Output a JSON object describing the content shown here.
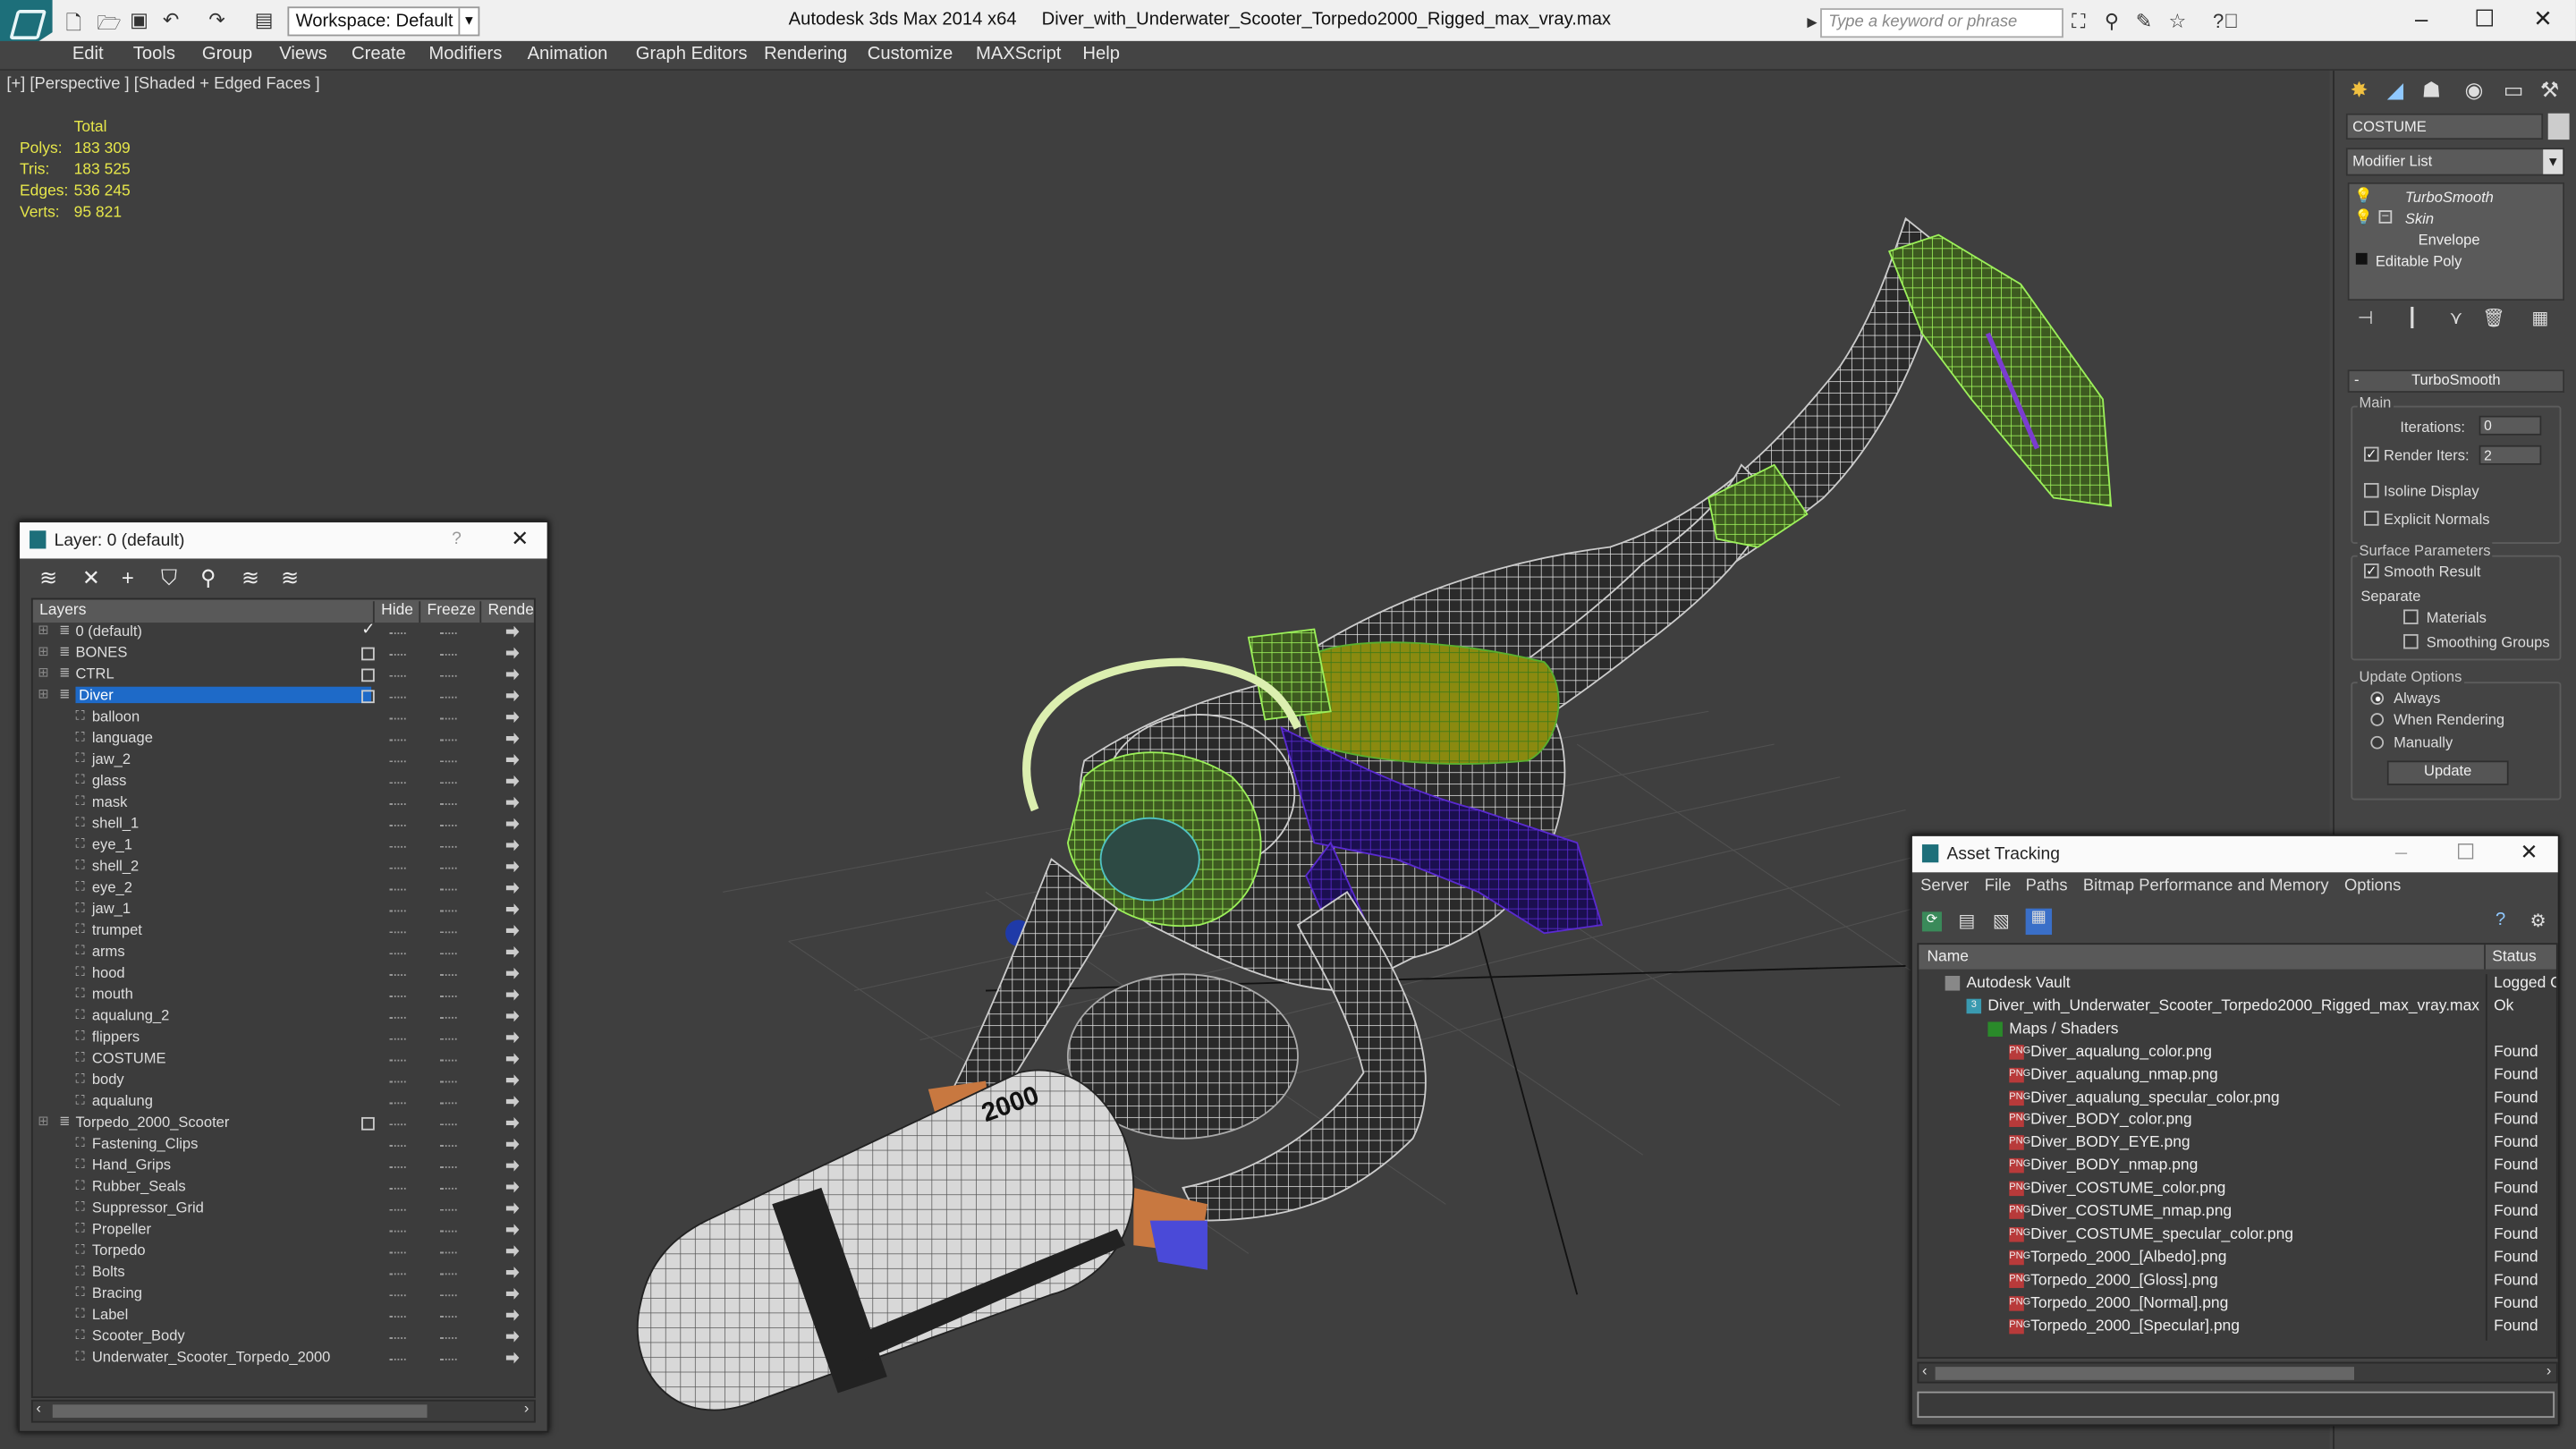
{
  "app": {
    "window_title": "Autodesk 3ds Max 2014 x64",
    "file_name": "Diver_with_Underwater_Scooter_Torpedo2000_Rigged_max_vray.max",
    "workspace": "Workspace: Default",
    "search_placeholder": "Type a keyword or phrase"
  },
  "menu": [
    "Edit",
    "Tools",
    "Group",
    "Views",
    "Create",
    "Modifiers",
    "Animation",
    "Graph Editors",
    "Rendering",
    "Customize",
    "MAXScript",
    "Help"
  ],
  "viewport": {
    "label": "[+] [Perspective ] [Shaded + Edged Faces ]",
    "stats_header": "Total",
    "stats": [
      {
        "k": "Polys:",
        "v": "183 309"
      },
      {
        "k": "Tris:",
        "v": "183 525"
      },
      {
        "k": "Edges:",
        "v": "536 245"
      },
      {
        "k": "Verts:",
        "v": "95 821"
      }
    ],
    "torpedo_text": "2000"
  },
  "command_panel": {
    "object_name": "COSTUME",
    "modifier_list": "Modifier List",
    "stack": [
      "TurboSmooth",
      "Skin",
      "Envelope",
      "Editable Poly"
    ],
    "rollout_title": "TurboSmooth",
    "main_group": "Main",
    "iterations_label": "Iterations:",
    "iterations_value": "0",
    "render_iters_label": "Render Iters:",
    "render_iters_value": "2",
    "isoline_display": "Isoline Display",
    "explicit_normals": "Explicit Normals",
    "surface_params": "Surface Parameters",
    "smooth_result": "Smooth Result",
    "separate": "Separate",
    "materials": "Materials",
    "smoothing_groups": "Smoothing Groups",
    "update_options": "Update Options",
    "always": "Always",
    "when_rendering": "When Rendering",
    "manually": "Manually",
    "update_button": "Update"
  },
  "layer_window": {
    "title": "Layer: 0 (default)",
    "help": "?",
    "columns": [
      "Layers",
      "Hide",
      "Freeze",
      "Render"
    ],
    "rows": [
      {
        "name": "0 (default)",
        "level": 0,
        "check": true
      },
      {
        "name": "BONES",
        "level": 0,
        "box": true
      },
      {
        "name": "CTRL",
        "level": 0,
        "box": true
      },
      {
        "name": "Diver",
        "level": 0,
        "box": true,
        "selected": true
      },
      {
        "name": "balloon",
        "level": 1
      },
      {
        "name": "language",
        "level": 1
      },
      {
        "name": "jaw_2",
        "level": 1
      },
      {
        "name": "glass",
        "level": 1
      },
      {
        "name": "mask",
        "level": 1
      },
      {
        "name": "shell_1",
        "level": 1
      },
      {
        "name": "eye_1",
        "level": 1
      },
      {
        "name": "shell_2",
        "level": 1
      },
      {
        "name": "eye_2",
        "level": 1
      },
      {
        "name": "jaw_1",
        "level": 1
      },
      {
        "name": "trumpet",
        "level": 1
      },
      {
        "name": "arms",
        "level": 1
      },
      {
        "name": "hood",
        "level": 1
      },
      {
        "name": "mouth",
        "level": 1
      },
      {
        "name": "aqualung_2",
        "level": 1
      },
      {
        "name": "flippers",
        "level": 1
      },
      {
        "name": "COSTUME",
        "level": 1
      },
      {
        "name": "body",
        "level": 1
      },
      {
        "name": "aqualung",
        "level": 1
      },
      {
        "name": "Torpedo_2000_Scooter",
        "level": 0,
        "box": true
      },
      {
        "name": "Fastening_Clips",
        "level": 1
      },
      {
        "name": "Hand_Grips",
        "level": 1
      },
      {
        "name": "Rubber_Seals",
        "level": 1
      },
      {
        "name": "Suppressor_Grid",
        "level": 1
      },
      {
        "name": "Propeller",
        "level": 1
      },
      {
        "name": "Torpedo",
        "level": 1
      },
      {
        "name": "Bolts",
        "level": 1
      },
      {
        "name": "Bracing",
        "level": 1
      },
      {
        "name": "Label",
        "level": 1
      },
      {
        "name": "Scooter_Body",
        "level": 1
      },
      {
        "name": "Underwater_Scooter_Torpedo_2000",
        "level": 1
      }
    ]
  },
  "asset_window": {
    "title": "Asset Tracking",
    "menu": [
      "Server",
      "File",
      "Paths",
      "Bitmap Performance and Memory",
      "Options"
    ],
    "col_name": "Name",
    "col_status": "Status",
    "rows": [
      {
        "name": "Autodesk Vault",
        "status": "Logged O",
        "level": 0,
        "icon": "vault"
      },
      {
        "name": "Diver_with_Underwater_Scooter_Torpedo2000_Rigged_max_vray.max",
        "status": "Ok",
        "level": 1,
        "icon": "max"
      },
      {
        "name": "Maps / Shaders",
        "status": "",
        "level": 2,
        "icon": "maps"
      },
      {
        "name": "Diver_aqualung_color.png",
        "status": "Found",
        "level": 3,
        "icon": "png"
      },
      {
        "name": "Diver_aqualung_nmap.png",
        "status": "Found",
        "level": 3,
        "icon": "png"
      },
      {
        "name": "Diver_aqualung_specular_color.png",
        "status": "Found",
        "level": 3,
        "icon": "png"
      },
      {
        "name": "Diver_BODY_color.png",
        "status": "Found",
        "level": 3,
        "icon": "png"
      },
      {
        "name": "Diver_BODY_EYE.png",
        "status": "Found",
        "level": 3,
        "icon": "png"
      },
      {
        "name": "Diver_BODY_nmap.png",
        "status": "Found",
        "level": 3,
        "icon": "png"
      },
      {
        "name": "Diver_COSTUME_color.png",
        "status": "Found",
        "level": 3,
        "icon": "png"
      },
      {
        "name": "Diver_COSTUME_nmap.png",
        "status": "Found",
        "level": 3,
        "icon": "png"
      },
      {
        "name": "Diver_COSTUME_specular_color.png",
        "status": "Found",
        "level": 3,
        "icon": "png"
      },
      {
        "name": "Torpedo_2000_[Albedo].png",
        "status": "Found",
        "level": 3,
        "icon": "png"
      },
      {
        "name": "Torpedo_2000_[Gloss].png",
        "status": "Found",
        "level": 3,
        "icon": "png"
      },
      {
        "name": "Torpedo_2000_[Normal].png",
        "status": "Found",
        "level": 3,
        "icon": "png"
      },
      {
        "name": "Torpedo_2000_[Specular].png",
        "status": "Found",
        "level": 3,
        "icon": "png"
      }
    ]
  },
  "colors": {
    "selection": "#1e6ac8",
    "stats": "#e6e64a",
    "wire_green": "#8be04a",
    "wire_purple": "#4a1fb0"
  }
}
